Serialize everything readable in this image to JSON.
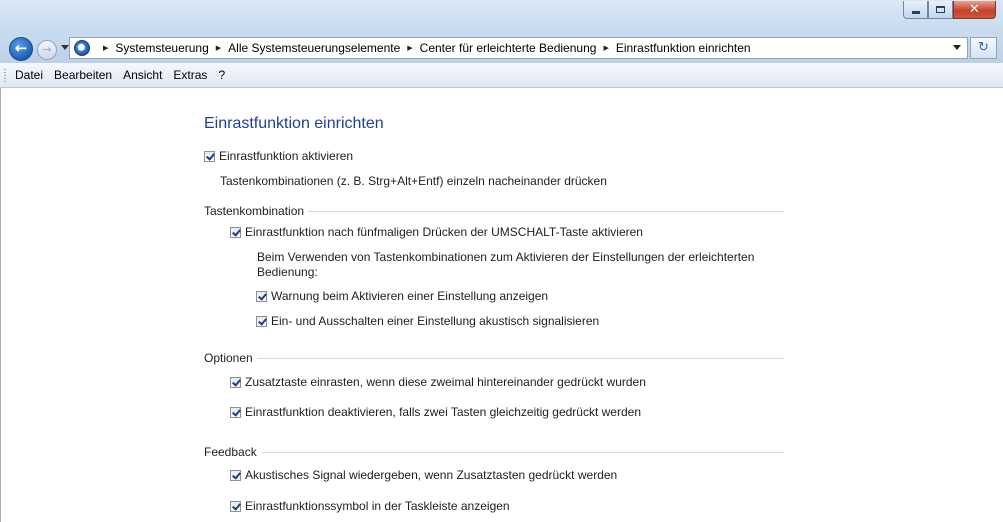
{
  "window": {
    "title_buttons": [
      "minimize-icon",
      "maximize-icon",
      "close-icon"
    ],
    "close_glyph": "✕"
  },
  "nav": {
    "back_glyph": "←",
    "forward_glyph": "→",
    "breadcrumbs": [
      "Systemsteuerung",
      "Alle Systemsteuerungselemente",
      "Center für erleichterte Bedienung",
      "Einrastfunktion einrichten"
    ],
    "separator": "▶",
    "refresh_glyph": "↻"
  },
  "menu": [
    "Datei",
    "Bearbeiten",
    "Ansicht",
    "Extras",
    "?"
  ],
  "page": {
    "title": "Einrastfunktion einrichten",
    "activate": {
      "label": "Einrastfunktion aktivieren",
      "checked": true
    },
    "activate_desc": "Tastenkombinationen (z. B. Strg+Alt+Entf) einzeln nacheinander drücken",
    "shortcut_group": {
      "label": "Tastenkombination",
      "shift5": {
        "label": "Einrastfunktion nach fünfmaligen Drücken der UMSCHALT-Taste aktivieren",
        "checked": true
      },
      "desc_line1": "Beim Verwenden von Tastenkombinationen zum Aktivieren der Einstellungen der erleichterten",
      "desc_line2": "Bedienung:",
      "warn": {
        "label": "Warnung beim Aktivieren einer Einstellung anzeigen",
        "checked": true
      },
      "sound": {
        "label": "Ein- und Ausschalten einer Einstellung akustisch signalisieren",
        "checked": true
      }
    },
    "options_group": {
      "label": "Optionen",
      "lock": {
        "label": "Zusatztaste einrasten, wenn diese zweimal hintereinander gedrückt wurden",
        "checked": true
      },
      "deactivate": {
        "label": "Einrastfunktion deaktivieren, falls zwei Tasten gleichzeitig gedrückt werden",
        "checked": true
      }
    },
    "feedback_group": {
      "label": "Feedback",
      "signal": {
        "label": "Akustisches Signal wiedergeben, wenn Zusatztasten gedrückt werden",
        "checked": true
      },
      "tray": {
        "label": "Einrastfunktionssymbol in der Taskleiste anzeigen",
        "checked": true
      }
    }
  },
  "colors": {
    "title_blue": "#1e3f9a",
    "titlebar": "#c6d9ee",
    "check": "#203a8c"
  }
}
